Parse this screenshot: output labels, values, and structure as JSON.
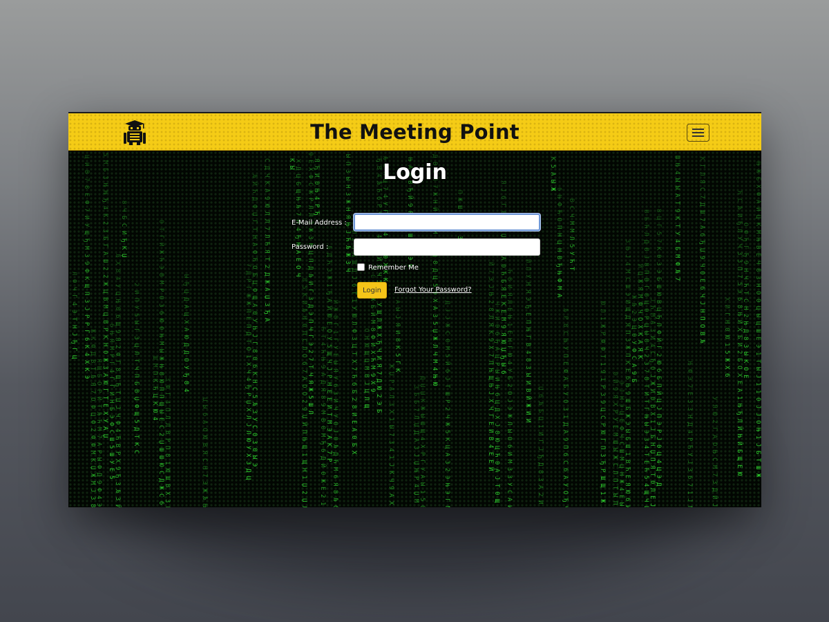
{
  "navbar": {
    "brand": "The Meeting Point",
    "logo_icon": "robot-graduate-icon",
    "menu_icon": "hamburger-menu-icon",
    "color": "#f5cc16"
  },
  "login": {
    "title": "Login",
    "email_label": "E-Mail Address :",
    "email_value": "",
    "password_label": "Password :",
    "password_value": "",
    "remember_label": "Remember Me",
    "remember_checked": false,
    "submit_label": "Login",
    "forgot_link": "Forgot Your Password?"
  },
  "background": {
    "style": "matrix-digital-rain",
    "glyph_color": "#2fd62f",
    "base_color": "#000000"
  }
}
